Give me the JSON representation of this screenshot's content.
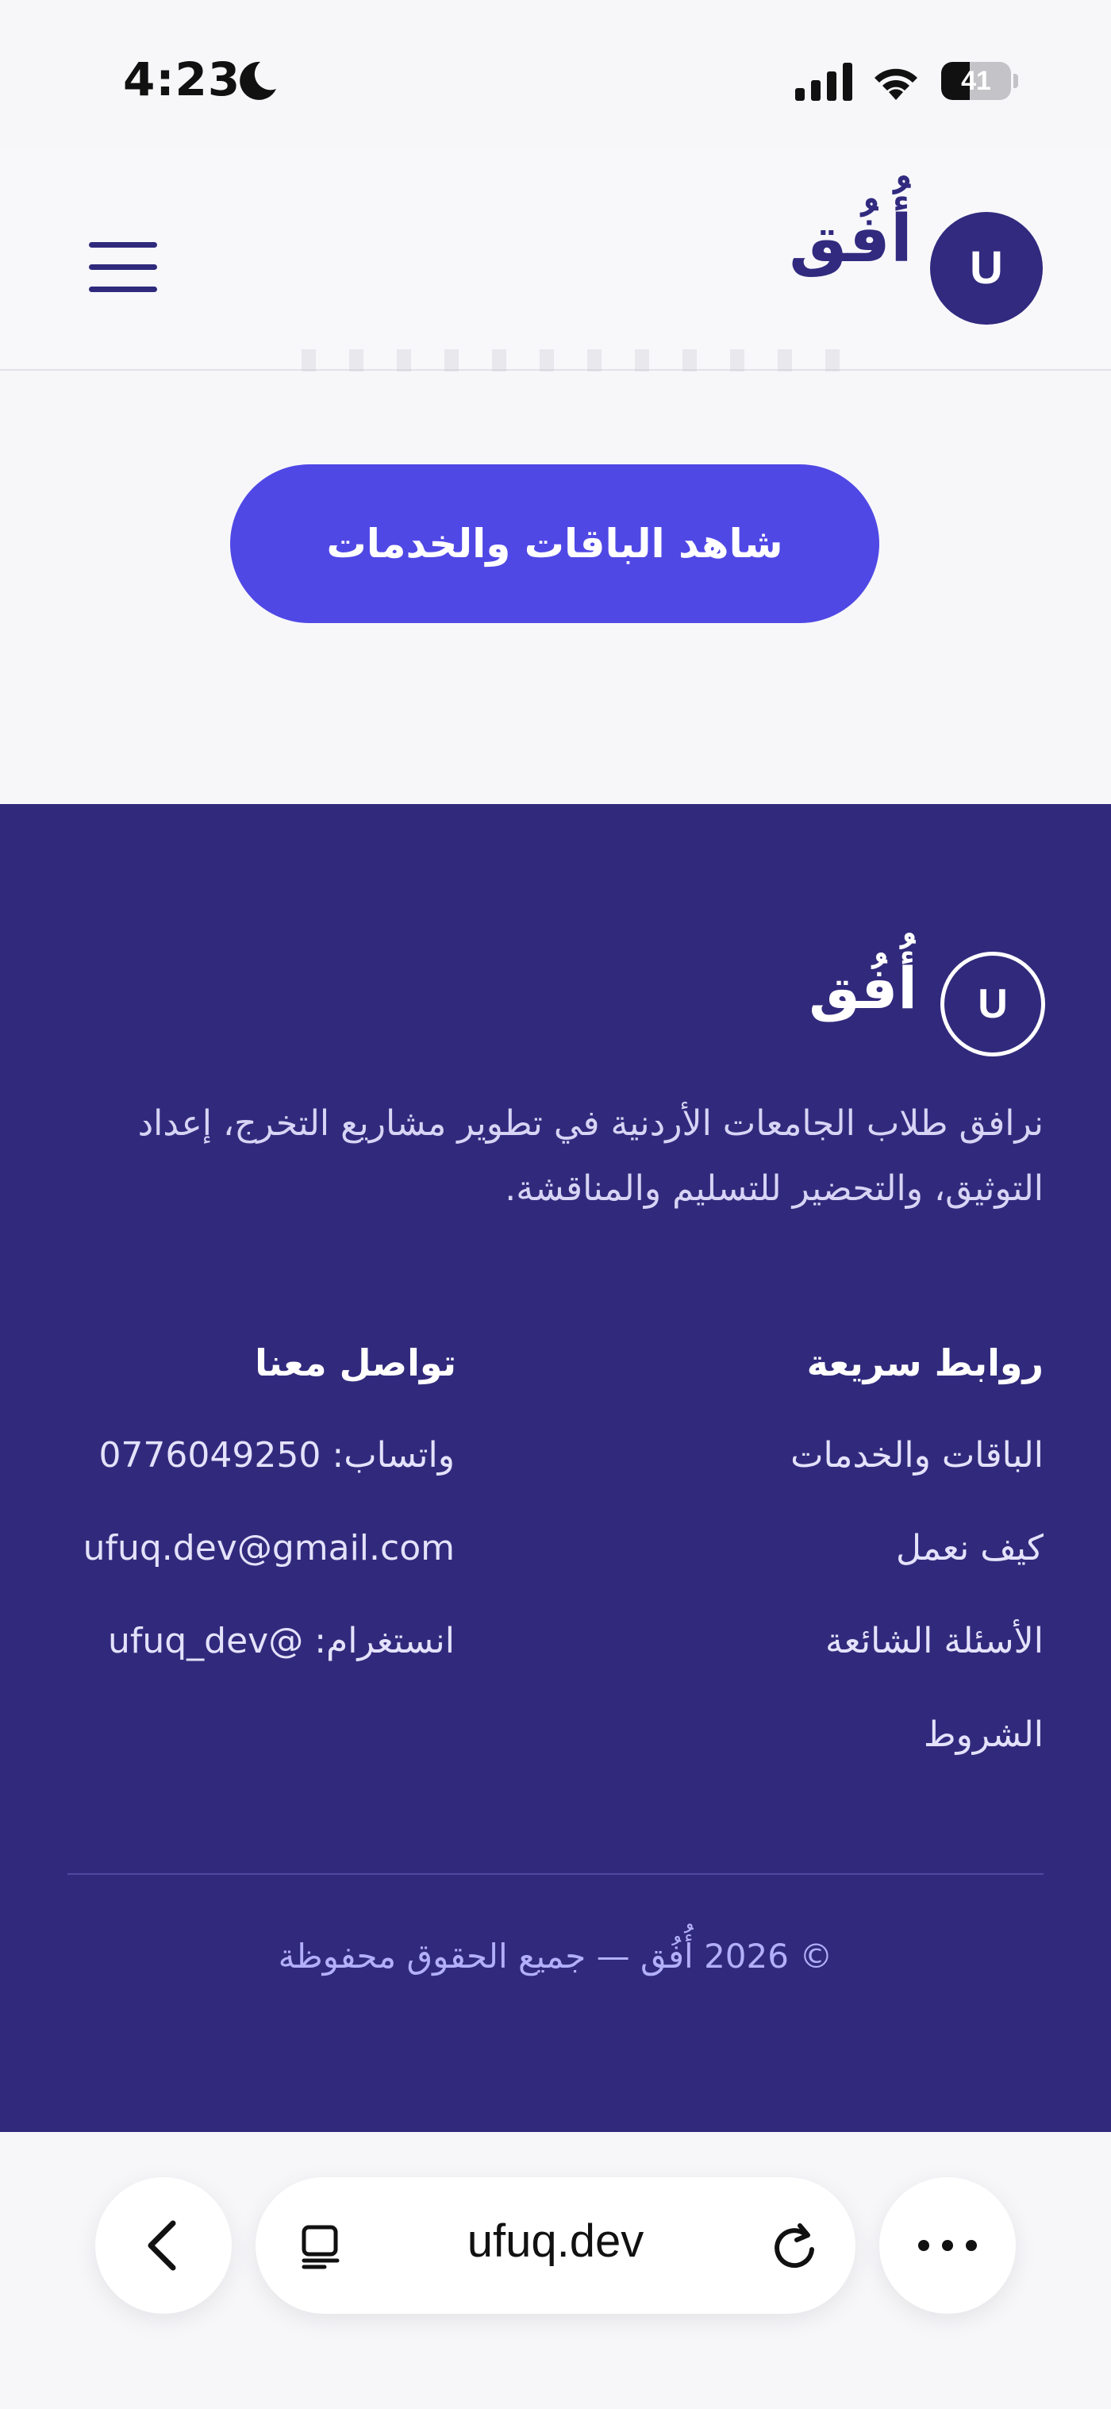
{
  "status_bar": {
    "time": "4:23",
    "battery_level": "41",
    "battery_fraction": 0.41,
    "icons": [
      "moon-icon",
      "signal-icon",
      "wifi-icon",
      "battery-icon"
    ]
  },
  "header": {
    "brand": "أُفُق",
    "logo_letter": "U",
    "menu_icon": "hamburger-menu-icon"
  },
  "cta": {
    "label": "شاهد الباقات والخدمات"
  },
  "footer": {
    "brand": "أُفُق",
    "logo_letter": "U",
    "description": "نرافق طلاب الجامعات الأردنية في تطوير مشاريع التخرج، إعداد التوثيق، والتحضير للتسليم والمناقشة.",
    "quick_links": {
      "title": "روابط سريعة",
      "items": [
        "الباقات والخدمات",
        "كيف نعمل",
        "الأسئلة الشائعة",
        "الشروط"
      ]
    },
    "contact": {
      "title": "تواصل معنا",
      "items": [
        "واتساب: 0776049250",
        "ufuq.dev@gmail.com",
        "انستغرام: @ufuq_dev"
      ]
    },
    "copyright": "© 2026 أُفُق — جميع الحقوق محفوظة"
  },
  "browser": {
    "url": "ufuq.dev",
    "icons": [
      "back-chevron-icon",
      "reader-icon",
      "reload-icon",
      "more-dots-icon"
    ]
  },
  "colors": {
    "brand_dark": "#312a7c",
    "accent": "#5048e5",
    "page_bg": "#f7f7fa"
  }
}
